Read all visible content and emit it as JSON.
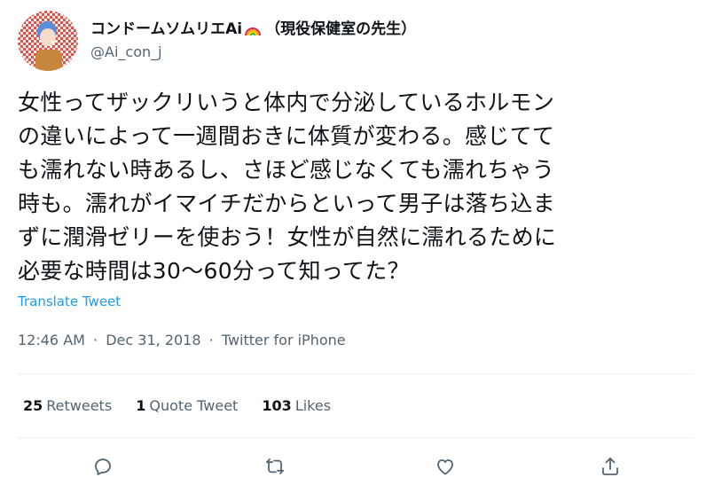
{
  "header": {
    "display_name": "コンドームソムリエAi",
    "display_name_suffix": "（現役保健室の先生）",
    "handle": "@Ai_con_j"
  },
  "tweet": {
    "lines": [
      "女性ってザックリいうと体内で分泌しているホルモン",
      "の違いによって一週間おきに体質が変わる。感じてて",
      "も濡れない時あるし、さほど感じなくても濡れちゃう",
      "時も。濡れがイマイチだからといって男子は落ち込ま",
      "ずに潤滑ゼリーを使おう！女性が自然に濡れるために",
      "必要な時間は30〜60分って知ってた？"
    ],
    "translate_label": "Translate Tweet"
  },
  "meta": {
    "time": "12:46 AM",
    "separator": "·",
    "date": "Dec 31, 2018",
    "source": "Twitter for iPhone"
  },
  "stats": {
    "retweets_count": "25",
    "retweets_label": "Retweets",
    "quotes_count": "1",
    "quotes_label": "Quote Tweet",
    "likes_count": "103",
    "likes_label": "Likes"
  },
  "actions": {
    "reply_icon": "reply-icon",
    "retweet_icon": "retweet-icon",
    "like_icon": "like-icon",
    "share_icon": "share-icon"
  },
  "colors": {
    "text": "#0f1419",
    "muted": "#536471",
    "link": "#1d9bf0",
    "divider": "#eff3f4"
  }
}
